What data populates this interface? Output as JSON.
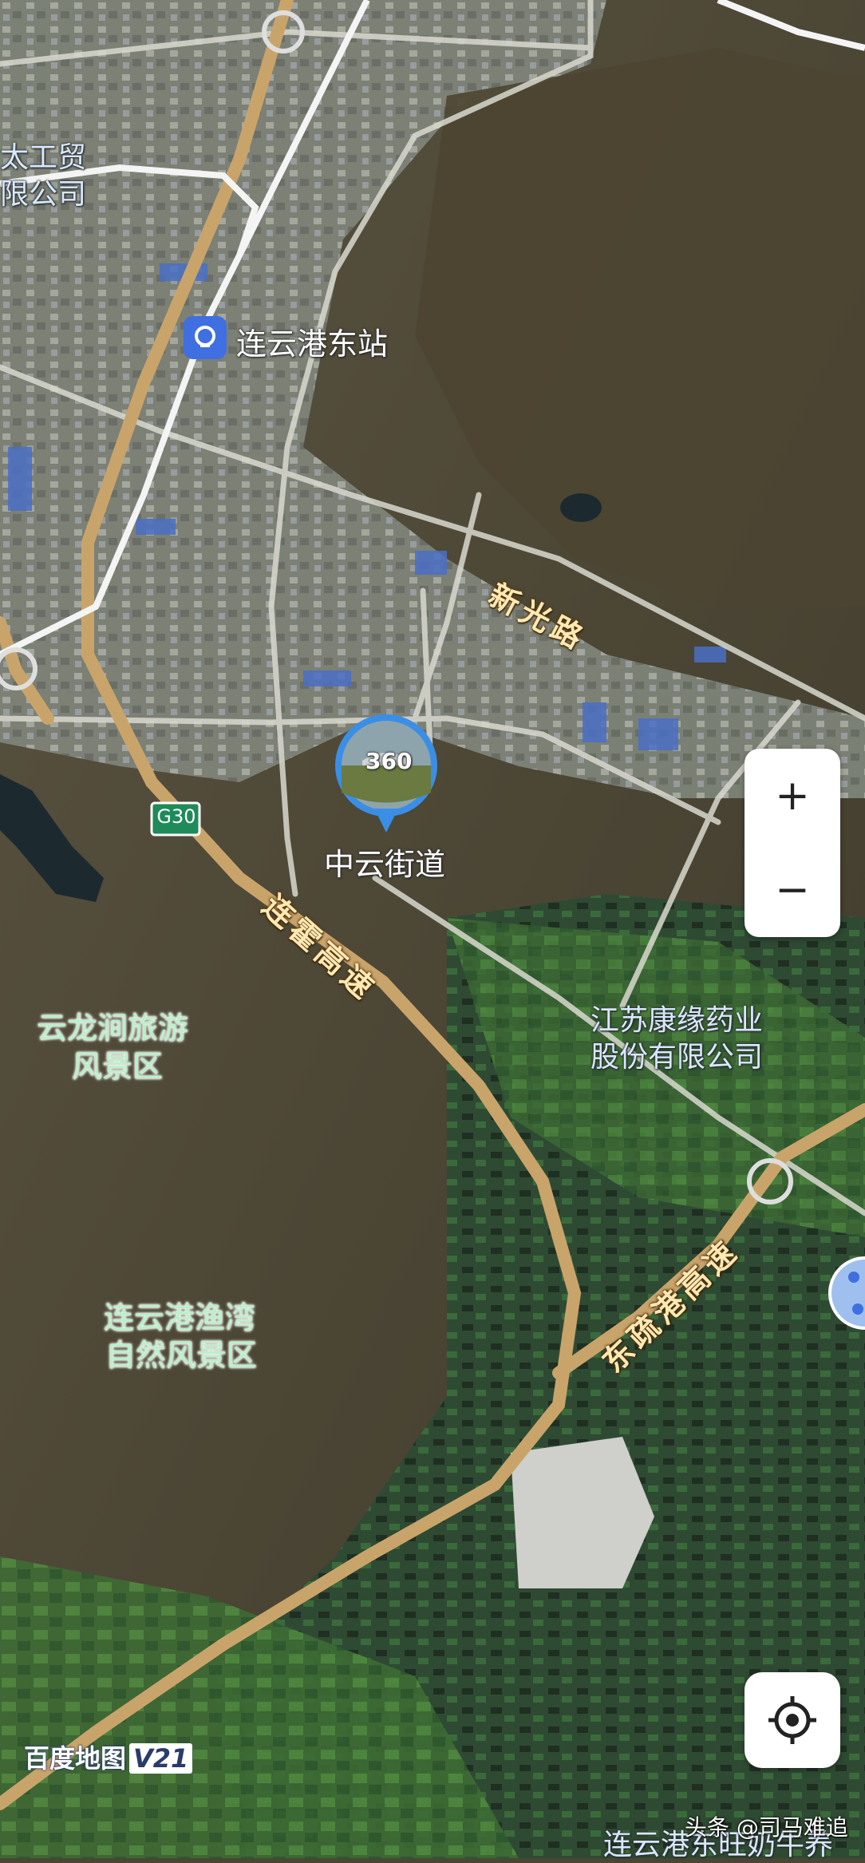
{
  "map": {
    "colors": {
      "mountain": "#4b4330",
      "farmland": "#3e6e36",
      "urban": "#8a8f86",
      "road_major": "#c9a46a",
      "road_minor": "#d8d8d0",
      "rail": "#f2f2f2",
      "water": "#1c2a30"
    }
  },
  "labels": {
    "station": "连云港东站",
    "company_partial_top": "太工贸",
    "company_partial_bottom": "限公司",
    "xinguang_road": "新光路",
    "zhongyun": "中云街道",
    "lianhuo_highway": "连霍高速",
    "kangyuan_line1": "江苏康缘药业",
    "kangyuan_line2": "股份有限公司",
    "yunlongjian_line1": "云龙涧旅游",
    "yunlongjian_line2": "风景区",
    "yuwan_line1": "连云港渔湾",
    "yuwan_line2": "自然风景区",
    "dongshu_highway": "东疏港高速",
    "bottom_partial": "连云港东旺奶牛养",
    "g30_shield": "G30"
  },
  "panorama": {
    "badge": "360",
    "icon": "panorama-360-icon"
  },
  "controls": {
    "zoom_in": "+",
    "zoom_out": "−",
    "locate_icon": "locate-crosshair-icon"
  },
  "brand": {
    "name": "百度地图",
    "version": "V21"
  },
  "watermark": "头条 @司马难追"
}
